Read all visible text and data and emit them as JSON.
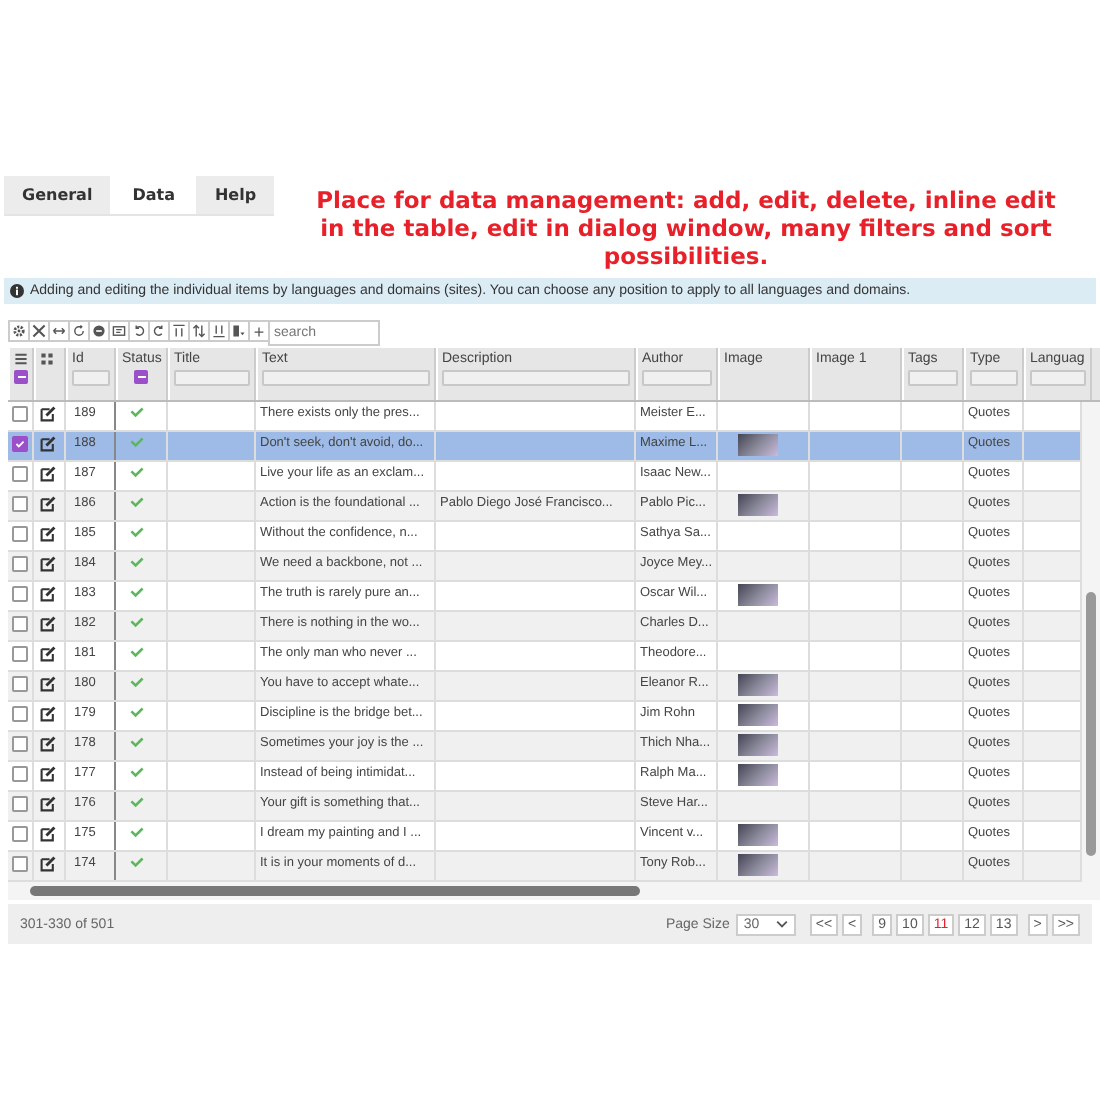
{
  "tabs": [
    {
      "label": "General",
      "selected": false
    },
    {
      "label": "Data",
      "selected": true
    },
    {
      "label": "Help",
      "selected": false
    }
  ],
  "caption": "Place for data management: add, edit, delete, inline edit in the table, edit in dialog window, many filters and sort possibilities.",
  "info": "Adding and editing the individual items by languages and domains (sites). You can choose any position to apply to all languages and domains.",
  "toolbar": {
    "add": "+",
    "search": {
      "placeholder": "search"
    }
  },
  "select_all": {
    "partial": true
  },
  "columns": [
    {
      "label": "Id",
      "kind": "text"
    },
    {
      "label": "Status",
      "kind": "check",
      "partial": true
    },
    {
      "label": "Title",
      "kind": "text"
    },
    {
      "label": "Text",
      "kind": "text"
    },
    {
      "label": "Description",
      "kind": "text"
    },
    {
      "label": "Author",
      "kind": "text"
    },
    {
      "label": "Image",
      "kind": "none"
    },
    {
      "label": "Image 1",
      "kind": "none"
    },
    {
      "label": "Tags",
      "kind": "text"
    },
    {
      "label": "Type",
      "kind": "text"
    },
    {
      "label": "Languag",
      "kind": "text"
    }
  ],
  "rows": [
    {
      "id": "189",
      "selected": false,
      "text": "There exists only the pres...",
      "description": "",
      "author": "Meister E...",
      "image": false,
      "type": "Quotes"
    },
    {
      "id": "188",
      "selected": true,
      "text": "Don't seek, don't avoid, do...",
      "description": "",
      "author": "Maxime L...",
      "image": true,
      "type": "Quotes"
    },
    {
      "id": "187",
      "selected": false,
      "text": "Live your life as an exclam...",
      "description": "",
      "author": "Isaac New...",
      "image": false,
      "type": "Quotes"
    },
    {
      "id": "186",
      "selected": false,
      "text": "Action is the foundational ...",
      "description": "Pablo Diego José Francisco...",
      "author": "Pablo Pic...",
      "image": true,
      "type": "Quotes"
    },
    {
      "id": "185",
      "selected": false,
      "text": "Without the confidence, n...",
      "description": "",
      "author": "Sathya Sa...",
      "image": false,
      "type": "Quotes"
    },
    {
      "id": "184",
      "selected": false,
      "text": "We need a backbone, not ...",
      "description": "",
      "author": "Joyce Mey...",
      "image": false,
      "type": "Quotes"
    },
    {
      "id": "183",
      "selected": false,
      "text": "The truth is rarely pure an...",
      "description": "",
      "author": "Oscar Wil...",
      "image": true,
      "type": "Quotes"
    },
    {
      "id": "182",
      "selected": false,
      "text": "There is nothing in the wo...",
      "description": "",
      "author": "Charles D...",
      "image": false,
      "type": "Quotes"
    },
    {
      "id": "181",
      "selected": false,
      "text": "The only man who never ...",
      "description": "",
      "author": "Theodore...",
      "image": false,
      "type": "Quotes"
    },
    {
      "id": "180",
      "selected": false,
      "text": "You have to accept whate...",
      "description": "",
      "author": "Eleanor R...",
      "image": true,
      "type": "Quotes"
    },
    {
      "id": "179",
      "selected": false,
      "text": "Discipline is the bridge bet...",
      "description": "",
      "author": "Jim Rohn",
      "image": true,
      "type": "Quotes"
    },
    {
      "id": "178",
      "selected": false,
      "text": "Sometimes your joy is the ...",
      "description": "",
      "author": "Thich Nha...",
      "image": true,
      "type": "Quotes"
    },
    {
      "id": "177",
      "selected": false,
      "text": "Instead of being intimidat...",
      "description": "",
      "author": "Ralph Ma...",
      "image": true,
      "type": "Quotes"
    },
    {
      "id": "176",
      "selected": false,
      "text": "Your gift is something that...",
      "description": "",
      "author": "Steve Har...",
      "image": false,
      "type": "Quotes"
    },
    {
      "id": "175",
      "selected": false,
      "text": "I dream my painting and I ...",
      "description": "",
      "author": "Vincent v...",
      "image": true,
      "type": "Quotes"
    },
    {
      "id": "174",
      "selected": false,
      "text": "It is in your moments of d...",
      "description": "",
      "author": "Tony Rob...",
      "image": true,
      "type": "Quotes"
    }
  ],
  "footer": {
    "range": "301-330 of 501",
    "page_size_label": "Page Size",
    "page_size": "30",
    "pages": [
      {
        "label": "<<",
        "selected": false
      },
      {
        "label": "<",
        "selected": false
      },
      {
        "label": "9",
        "selected": false
      },
      {
        "label": "10",
        "selected": false
      },
      {
        "label": "11",
        "selected": true
      },
      {
        "label": "12",
        "selected": false
      },
      {
        "label": "13",
        "selected": false
      },
      {
        "label": ">",
        "selected": false
      },
      {
        "label": ">>",
        "selected": false
      }
    ]
  }
}
